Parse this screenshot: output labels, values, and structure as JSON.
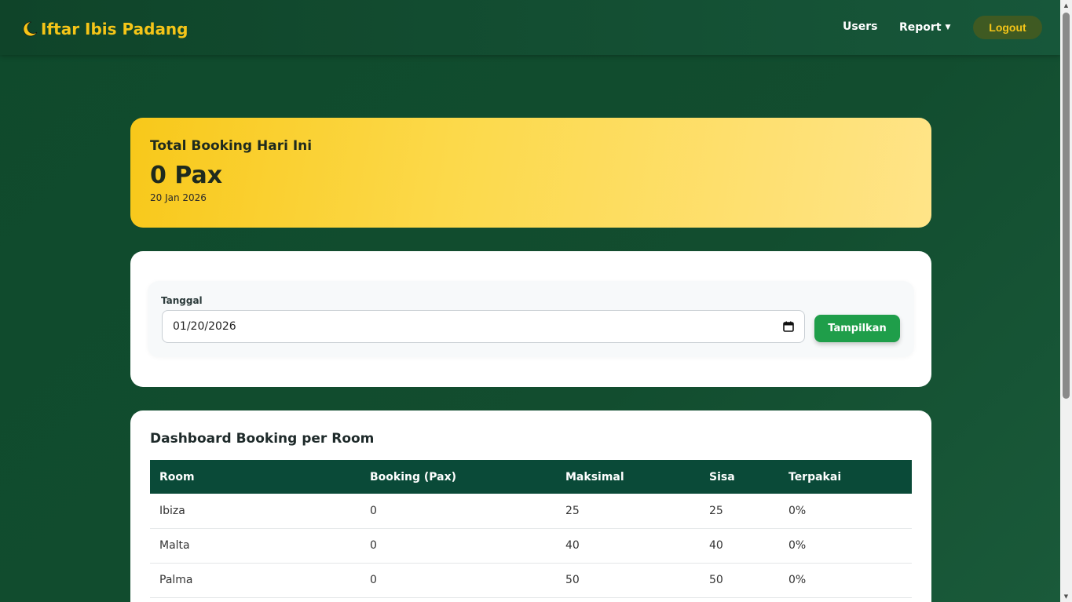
{
  "navbar": {
    "brand": "Iftar Ibis Padang",
    "links": {
      "users": "Users",
      "report": "Report"
    },
    "logout": "Logout",
    "colors": {
      "brand": "#f5c518",
      "background": "#0f4429"
    }
  },
  "summary": {
    "title": "Total Booking Hari Ini",
    "value": "0 Pax",
    "date": "20 Jan 2026"
  },
  "filter": {
    "label": "Tanggal",
    "date_value": "01/20/2026",
    "button": "Tampilkan"
  },
  "table": {
    "title": "Dashboard Booking per Room",
    "columns": [
      "Room",
      "Booking (Pax)",
      "Maksimal",
      "Sisa",
      "Terpakai"
    ],
    "rows": [
      [
        "Ibiza",
        "0",
        "25",
        "25",
        "0%"
      ],
      [
        "Malta",
        "0",
        "40",
        "40",
        "0%"
      ],
      [
        "Palma",
        "0",
        "50",
        "50",
        "0%"
      ]
    ]
  }
}
